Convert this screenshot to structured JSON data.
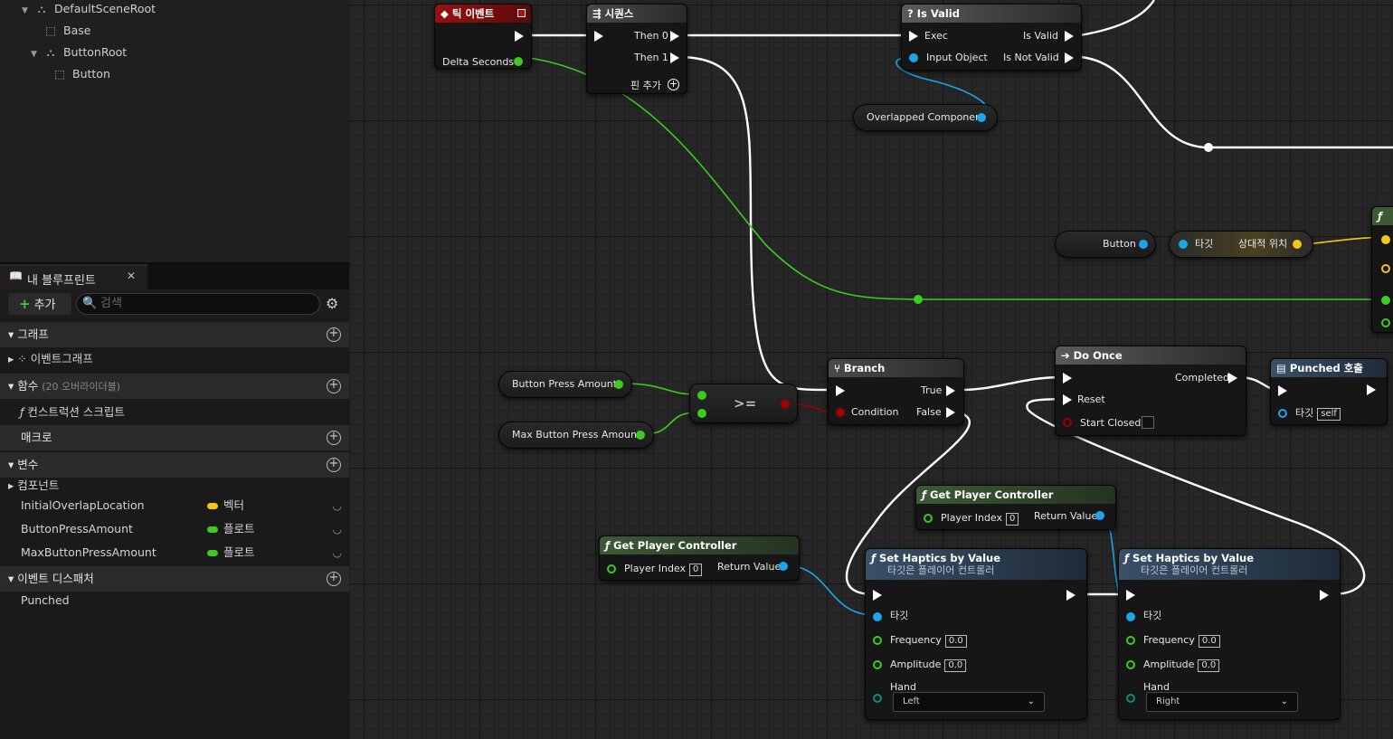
{
  "components": {
    "items": [
      {
        "label": "DefaultSceneRoot"
      },
      {
        "label": "Base"
      },
      {
        "label": "ButtonRoot"
      },
      {
        "label": "Button"
      }
    ]
  },
  "my_blueprint": {
    "tab_title": "내 블루프린트",
    "add_label": "추가",
    "search_placeholder": "검색",
    "sections": {
      "graphs": "그래프",
      "event_graph": "이벤트그래프",
      "functions": "함수",
      "functions_sub": "(20 오버라이더블)",
      "construction_script": "컨스트럭션 스크립트",
      "macros": "매크로",
      "variables": "변수",
      "components": "컴포넌트",
      "event_dispatchers": "이벤트 디스패처"
    },
    "variables": [
      {
        "name": "InitialOverlapLocation",
        "type": "벡터",
        "color": "#f5c518"
      },
      {
        "name": "ButtonPressAmount",
        "type": "플로트",
        "color": "#3ccb21"
      },
      {
        "name": "MaxButtonPressAmount",
        "type": "플로트",
        "color": "#3ccb21"
      }
    ],
    "dispatchers": [
      {
        "name": "Punched"
      }
    ]
  },
  "graph": {
    "tick": {
      "title": "틱 이벤트",
      "delta": "Delta Seconds"
    },
    "sequence": {
      "title": "시퀀스",
      "then0": "Then 0",
      "then1": "Then 1",
      "add_pin": "핀 추가"
    },
    "isvalid": {
      "title": "Is Valid",
      "exec": "Exec",
      "input": "Input Object",
      "valid": "Is Valid",
      "notvalid": "Is Not Valid"
    },
    "overlapped": "Overlapped Component",
    "button_var": "Button",
    "rel_loc": {
      "target": "타깃",
      "label": "상대적 위치"
    },
    "bpa": "Button Press Amount",
    "mbpa": "Max Button Press Amount",
    "gte": ">=",
    "branch": {
      "title": "Branch",
      "cond": "Condition",
      "true": "True",
      "false": "False"
    },
    "doonce": {
      "title": "Do Once",
      "completed": "Completed",
      "reset": "Reset",
      "start_closed": "Start Closed"
    },
    "punched": {
      "title": "Punched 호출",
      "target": "타깃",
      "self": "self"
    },
    "gpc1": {
      "title": "Get Player Controller",
      "index_label": "Player Index",
      "index": "0",
      "ret": "Return Value"
    },
    "gpc2": {
      "title": "Get Player Controller",
      "index_label": "Player Index",
      "index": "0",
      "ret": "Return Value"
    },
    "haptics1": {
      "title": "Set Haptics by Value",
      "sub": "타깃은 플레이어 컨트롤러",
      "target": "타깃",
      "freq": "Frequency",
      "freq_v": "0.0",
      "amp": "Amplitude",
      "amp_v": "0.0",
      "hand": "Hand",
      "hand_v": "Left"
    },
    "haptics2": {
      "title": "Set Haptics by Value",
      "sub": "타깃은 플레이어 컨트롤러",
      "target": "타깃",
      "freq": "Frequency",
      "freq_v": "0.0",
      "amp": "Amplitude",
      "amp_v": "0.0",
      "hand": "Hand",
      "hand_v": "Right"
    }
  },
  "colors": {
    "exec": "#ffffff",
    "float": "#3ccb21",
    "object": "#1aa7ec",
    "vector": "#f5c518",
    "bool": "#a00000",
    "event_header": "#8a1010",
    "func_header": "#3a5068",
    "pure_header": "#3d5a35",
    "flow_header": "#3a3a3a"
  }
}
